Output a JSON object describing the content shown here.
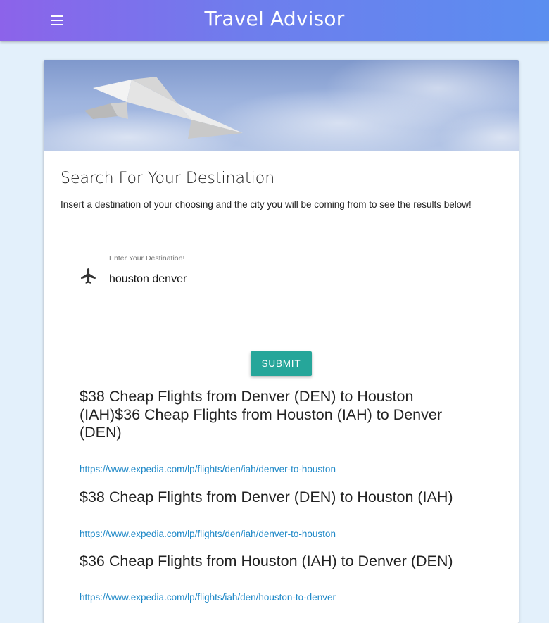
{
  "header": {
    "title": "Travel Advisor",
    "menu_icon": "menu-icon"
  },
  "hero": {
    "image": "paper-airplane-sky"
  },
  "search": {
    "title": "Search For Your Destination",
    "description": "Insert a destination of your choosing and the city you will be coming from to see the results below!",
    "field_icon": "airplane-icon",
    "field_label": "Enter Your Destination!",
    "field_value": "houston denver",
    "submit_label": "SUBMIT"
  },
  "results": [
    {
      "heading": "$38 Cheap Flights from Denver (DEN) to Houston (IAH)$36 Cheap Flights from Houston (IAH) to Denver (DEN)",
      "url": "https://www.expedia.com/lp/flights/den/iah/denver-to-houston"
    },
    {
      "heading": "$38 Cheap Flights from Denver (DEN) to Houston (IAH)",
      "url": "https://www.expedia.com/lp/flights/den/iah/denver-to-houston"
    },
    {
      "heading": "$36 Cheap Flights from Houston (IAH) to Denver (DEN)",
      "url": "https://www.expedia.com/lp/flights/iah/den/houston-to-denver"
    }
  ],
  "colors": {
    "appbar_start": "#8c63ea",
    "appbar_end": "#5b8ef0",
    "page_background": "#e3f0fb",
    "button": "#26a69a",
    "link": "#1e88c7"
  }
}
